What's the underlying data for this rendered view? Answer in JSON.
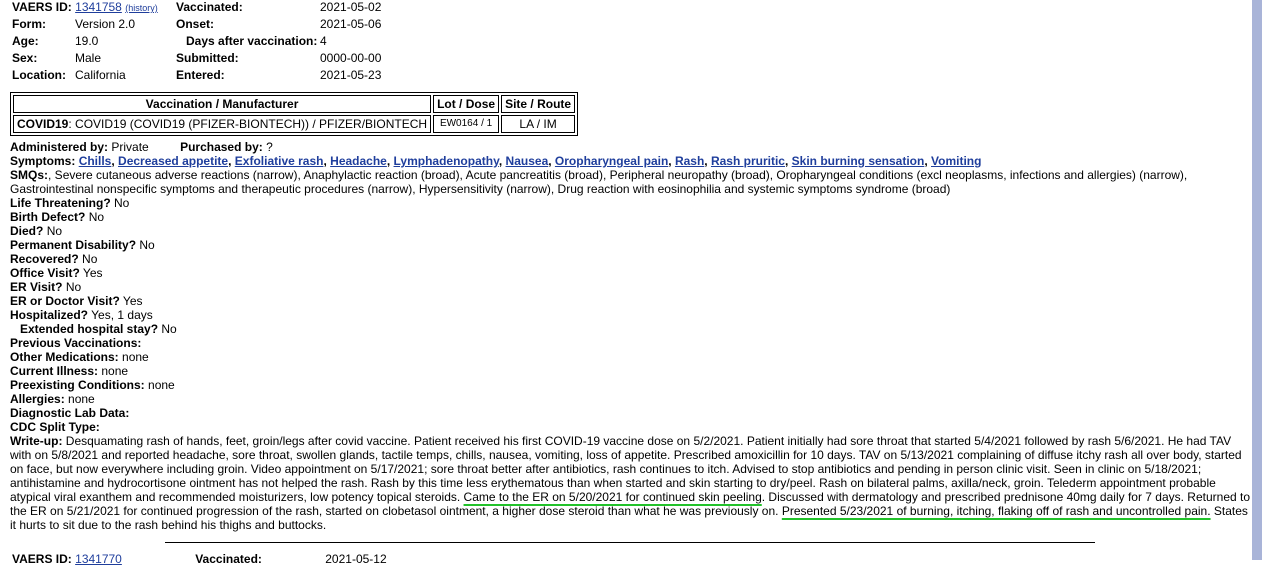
{
  "header": {
    "vaers_label": "VAERS ID:",
    "vaers_id": "1341758",
    "history": "(history)",
    "form_label": "Form:",
    "form": "Version 2.0",
    "age_label": "Age:",
    "age": "19.0",
    "sex_label": "Sex:",
    "sex": "Male",
    "location_label": "Location:",
    "location": "California",
    "vaccinated_label": "Vaccinated:",
    "vaccinated": "2021-05-02",
    "onset_label": "Onset:",
    "onset": "2021-05-06",
    "days_label": "Days after vaccination:",
    "days": "4",
    "submitted_label": "Submitted:",
    "submitted": "0000-00-00",
    "entered_label": "Entered:",
    "entered": "2021-05-23"
  },
  "vax_table": {
    "headers": [
      "Vaccination / Manufacturer",
      "Lot / Dose",
      "Site / Route"
    ],
    "vax_type": "COVID19",
    "vax_name": ": COVID19 (COVID19 (PFIZER-BIONTECH)) / PFIZER/BIONTECH",
    "lot": "EW0164 / 1",
    "site": "LA / IM"
  },
  "admin": {
    "administered_label": "Administered by:",
    "administered": "Private",
    "purchased_label": "Purchased by:",
    "purchased": "?"
  },
  "symptoms": {
    "label": "Symptoms:",
    "items": [
      "Chills",
      "Decreased appetite",
      "Exfoliative rash",
      "Headache",
      "Lymphadenopathy",
      "Nausea",
      "Oropharyngeal pain",
      "Rash",
      "Rash pruritic",
      "Skin burning sensation",
      "Vomiting"
    ]
  },
  "smqs": {
    "label": "SMQs:",
    "text": ", Severe cutaneous adverse reactions (narrow), Anaphylactic reaction (broad), Acute pancreatitis (broad), Peripheral neuropathy (broad), Oropharyngeal conditions (excl neoplasms, infections and allergies) (narrow), Gastrointestinal nonspecific symptoms and therapeutic procedures (narrow), Hypersensitivity (narrow), Drug reaction with eosinophilia and systemic symptoms syndrome (broad)"
  },
  "fields": [
    {
      "label": "Life Threatening?",
      "value": "No"
    },
    {
      "label": "Birth Defect?",
      "value": "No"
    },
    {
      "label": "Died?",
      "value": "No"
    },
    {
      "label": "Permanent Disability?",
      "value": "No"
    },
    {
      "label": "Recovered?",
      "value": "No"
    },
    {
      "label": "Office Visit?",
      "value": "Yes"
    },
    {
      "label": "ER Visit?",
      "value": "No"
    },
    {
      "label": "ER or Doctor Visit?",
      "value": "Yes"
    },
    {
      "label": "Hospitalized?",
      "value": "Yes, 1 days"
    },
    {
      "label": "Extended hospital stay?",
      "value": "No"
    },
    {
      "label": "Previous Vaccinations:",
      "value": ""
    },
    {
      "label": "Other Medications:",
      "value": "none"
    },
    {
      "label": "Current Illness:",
      "value": "none"
    },
    {
      "label": "Preexisting Conditions:",
      "value": "none"
    },
    {
      "label": "Allergies:",
      "value": "none"
    },
    {
      "label": "Diagnostic Lab Data:",
      "value": ""
    },
    {
      "label": "CDC Split Type:",
      "value": ""
    }
  ],
  "writeup": {
    "label": "Write-up:",
    "part1": "Desquamating rash of hands, feet, groin/legs after covid vaccine. Patient received his first COVID-19 vaccine dose on 5/2/2021. Patient initially had sore throat that started 5/4/2021 followed by rash 5/6/2021. He had TAV with on 5/8/2021 and reported headache, sore throat, swollen glands, tactile temps, chills, nausea, vomiting, loss of appetite. Prescribed amoxicillin for 10 days. TAV on 5/13/2021 complaining of diffuse itchy rash all over body, started on face, but now everywhere including groin. Video appointment on 5/17/2021; sore throat better after antibiotics, rash continues to itch. Advised to stop antibiotics and pending in person clinic visit. Seen in clinic on 5/18/2021; antihistamine and hydrocortisone ointment has not helped the rash. Rash by this time less erythematous than when started and skin starting to dry/peel. Rash on bilateral palms, axilla/neck, groin. Telederm appointment probable atypical viral exanthem and recommended moisturizers, low potency topical steroids. ",
    "highlight1": "Came to the ER on 5/20/2021 for continued skin peeling",
    "part2": ". Discussed with dermatology and prescribed prednisone 40mg daily for 7 days. Returned to the ER on 5/21/2021 for continued progression of the rash, started on clobetasol ointment, a higher dose steroid than what he was previously on. ",
    "highlight2": "Presented 5/23/2021 of burning, itching, flaking off of rash and uncontrolled pain.",
    "part3": " States it hurts to sit due to the rash behind his thighs and buttocks."
  },
  "next": {
    "vaers_label": "VAERS ID:",
    "vaers_id": "1341770",
    "vaccinated_label": "Vaccinated:",
    "vaccinated": "2021-05-12"
  },
  "colors": {
    "link": "#1f3e9c",
    "highlight_underline": "#22c22a",
    "frame": "#a9b4d8"
  }
}
